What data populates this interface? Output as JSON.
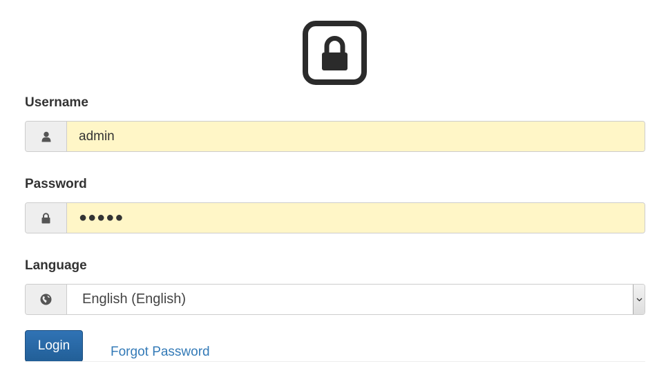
{
  "form": {
    "username": {
      "label": "Username",
      "value": "admin"
    },
    "password": {
      "label": "Password",
      "value": "●●●●●"
    },
    "language": {
      "label": "Language",
      "selected": "English (English)"
    }
  },
  "actions": {
    "login_label": "Login",
    "forgot_label": "Forgot Password"
  },
  "icons": {
    "logo": "lock-icon",
    "username": "user-icon",
    "password": "lock-icon",
    "language": "globe-icon",
    "select": "chevron-down-icon"
  },
  "colors": {
    "primary": "#286090",
    "link": "#337ab7",
    "autofill": "#fff6c7"
  }
}
